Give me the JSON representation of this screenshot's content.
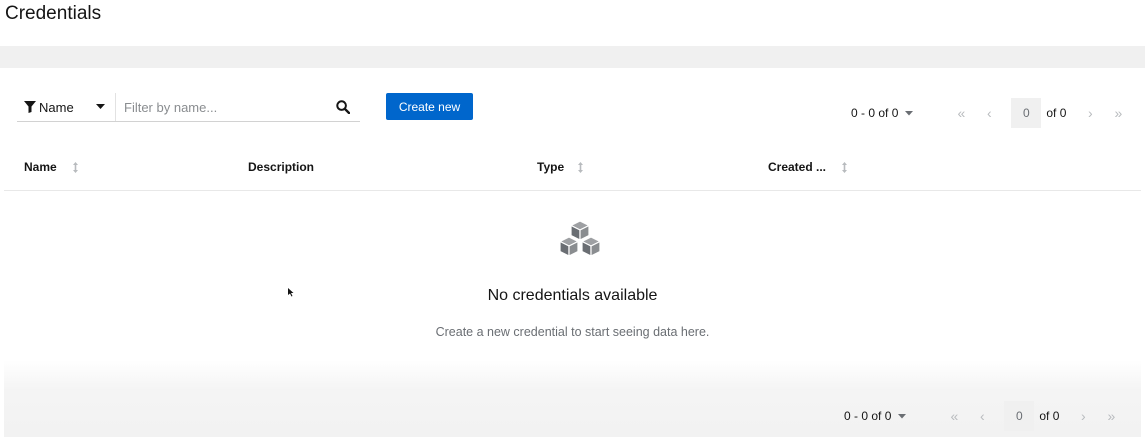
{
  "header": {
    "title": "Credentials"
  },
  "toolbar": {
    "filter_type_label": "Name",
    "search_placeholder": "Filter by name...",
    "create_label": "Create new"
  },
  "pagination_top": {
    "count_label": "0 - 0 of 0",
    "page_value": "0",
    "of_label": "of 0"
  },
  "table": {
    "columns": [
      {
        "label": "Name",
        "sortable": true
      },
      {
        "label": "Description",
        "sortable": false
      },
      {
        "label": "Type",
        "sortable": true
      },
      {
        "label": "Created ...",
        "sortable": true
      }
    ]
  },
  "empty_state": {
    "icon": "cubes-icon",
    "title": "No credentials available",
    "body": "Create a new credential to start seeing data here."
  },
  "pagination_bottom": {
    "count_label": "0 - 0 of 0",
    "page_value": "0",
    "of_label": "of 0"
  },
  "colors": {
    "primary": "#0066cc",
    "text": "#151515",
    "muted_text": "#6a6e73",
    "disabled": "#b8bbbe"
  }
}
